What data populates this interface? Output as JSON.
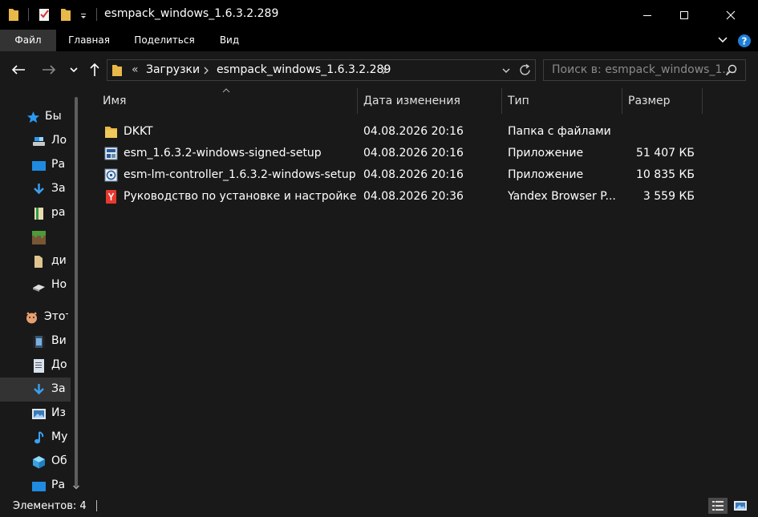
{
  "window": {
    "title": "esmpack_windows_1.6.3.2.289",
    "controls": [
      "minimize-icon",
      "maximize-icon",
      "close-icon"
    ]
  },
  "ribbon": {
    "tabs": [
      "Файл",
      "Главная",
      "Поделиться",
      "Вид"
    ]
  },
  "address": {
    "overflow": "«",
    "segments": [
      "Загрузки",
      "esmpack_windows_1.6.3.2.289"
    ]
  },
  "search": {
    "placeholder": "Поиск в: esmpack_windows_1...."
  },
  "sidebar": {
    "items": [
      {
        "label": "Быс",
        "icon": "star-icon"
      },
      {
        "label": "Ло",
        "icon": "drive-icon"
      },
      {
        "label": "Ра",
        "icon": "desktop-icon"
      },
      {
        "label": "За",
        "icon": "download-icon"
      },
      {
        "label": "ра",
        "icon": "notebook-icon"
      },
      {
        "label": "",
        "icon": "grass-block-icon"
      },
      {
        "label": "ди",
        "icon": "folder-icon"
      },
      {
        "label": "Но",
        "icon": "device-icon"
      },
      {
        "label": "Этот",
        "icon": "this-pc-icon"
      },
      {
        "label": "Ви",
        "icon": "video-icon"
      },
      {
        "label": "До",
        "icon": "documents-icon"
      },
      {
        "label": "За",
        "icon": "download-icon"
      },
      {
        "label": "Из",
        "icon": "pictures-icon"
      },
      {
        "label": "Му",
        "icon": "music-icon"
      },
      {
        "label": "Об",
        "icon": "3d-objects-icon"
      },
      {
        "label": "Ра",
        "icon": "desktop-icon"
      }
    ]
  },
  "columns": [
    "Имя",
    "Дата изменения",
    "Тип",
    "Размер"
  ],
  "files": [
    {
      "name": "DKKT",
      "date": "04.08.2026 20:16",
      "type": "Папка с файлами",
      "size": "",
      "icon": "folder-icon"
    },
    {
      "name": "esm_1.6.3.2-windows-signed-setup",
      "date": "04.08.2026 20:16",
      "type": "Приложение",
      "size": "51 407 КБ",
      "icon": "installer-icon"
    },
    {
      "name": "esm-lm-controller_1.6.3.2-windows-setup",
      "date": "04.08.2026 20:16",
      "type": "Приложение",
      "size": "10 835 КБ",
      "icon": "installer-icon"
    },
    {
      "name": "Руководство по установке и настройке...",
      "date": "04.08.2026 20:36",
      "type": "Yandex Browser P...",
      "size": "3 559 КБ",
      "icon": "pdf-icon"
    }
  ],
  "status": {
    "items_count": "Элементов: 4"
  }
}
